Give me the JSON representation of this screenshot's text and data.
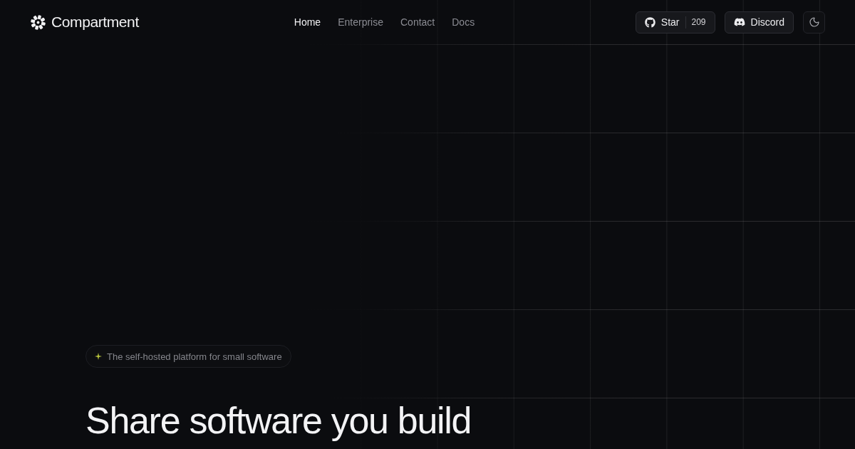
{
  "header": {
    "logo": {
      "text": "Compartment"
    },
    "nav": [
      {
        "label": "Home",
        "selected": true
      },
      {
        "label": "Enterprise",
        "selected": false
      },
      {
        "label": "Contact",
        "selected": false
      },
      {
        "label": "Docs",
        "selected": false
      }
    ],
    "star_button": {
      "label": "Star",
      "count": "209"
    },
    "discord_button": {
      "label": "Discord"
    }
  },
  "hero": {
    "badge": "The self-hosted platform for small software",
    "headline": "Share software you build"
  }
}
